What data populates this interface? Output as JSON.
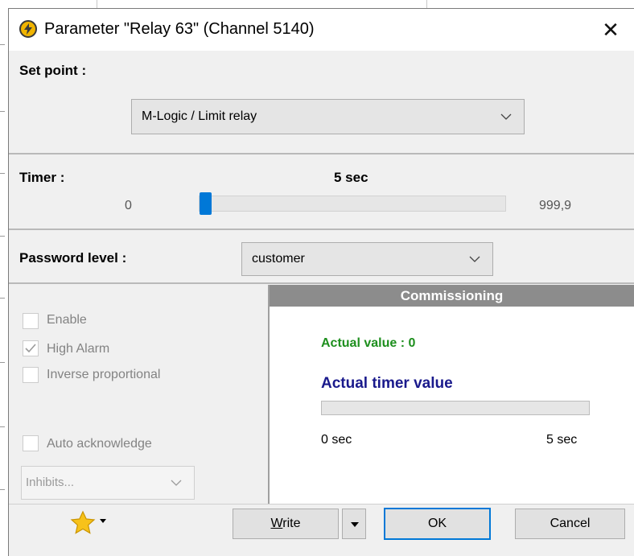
{
  "title_bar": {
    "title": "Parameter \"Relay 63\" (Channel 5140)",
    "close_glyph": "✕",
    "app_icon": "lightning-icon"
  },
  "setpoint": {
    "label": "Set point :",
    "value": "M-Logic / Limit relay"
  },
  "timer": {
    "label": "Timer :",
    "value": "5 sec",
    "min": "0",
    "max": "999,9",
    "slider_fraction": 0.005
  },
  "password": {
    "label": "Password level :",
    "value": "customer"
  },
  "options": {
    "enable": {
      "label": "Enable",
      "checked": false
    },
    "high_alarm": {
      "label": "High Alarm",
      "checked": true
    },
    "inverse_proportional": {
      "label": "Inverse proportional",
      "checked": false
    },
    "auto_acknowledge": {
      "label": "Auto acknowledge",
      "checked": false
    },
    "inhibits_placeholder": "Inhibits..."
  },
  "commissioning": {
    "header": "Commissioning",
    "actual_value": "Actual value : 0",
    "actual_timer_label": "Actual timer value",
    "timer_min": "0 sec",
    "timer_max": "5 sec",
    "timer_progress": 0,
    "colors": {
      "actual_value": "#1e8f1e",
      "timer_label": "#1a1a8c"
    }
  },
  "footer": {
    "favorites_icon": "star-icon",
    "write_label": "Write",
    "write_mnemonic": "W",
    "write_rest": "rite",
    "ok_label": "OK",
    "cancel_label": "Cancel"
  },
  "colors": {
    "accent": "#0078d7",
    "panel_header": "#8c8c8c"
  }
}
